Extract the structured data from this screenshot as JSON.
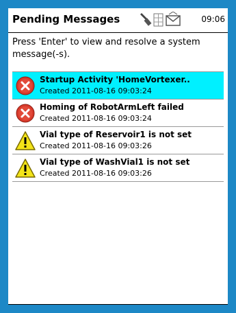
{
  "header": {
    "title": "Pending Messages",
    "time": "09:06",
    "icons": [
      "wrench-icon",
      "status-grid-icon",
      "mail-icon"
    ]
  },
  "instruction": "Press 'Enter' to view and resolve a system message(-s).",
  "messages": [
    {
      "title": "Startup Activity 'HomeVortexer..",
      "created": "Created 2011-08-16 09:03:24",
      "severity": "error",
      "selected": true
    },
    {
      "title": "Homing of RobotArmLeft failed",
      "created": "Created 2011-08-16 09:03:24",
      "severity": "error",
      "selected": false
    },
    {
      "title": "Vial type of Reservoir1 is not set",
      "created": "Created 2011-08-16 09:03:26",
      "severity": "warning",
      "selected": false
    },
    {
      "title": "Vial type of WashVial1 is not set",
      "created": "Created 2011-08-16 09:03:26",
      "severity": "warning",
      "selected": false
    }
  ],
  "colors": {
    "frame": "#1d88c6",
    "selected_row": "#00f0ff",
    "error": "#d83a2b",
    "warning": "#f3e418"
  }
}
